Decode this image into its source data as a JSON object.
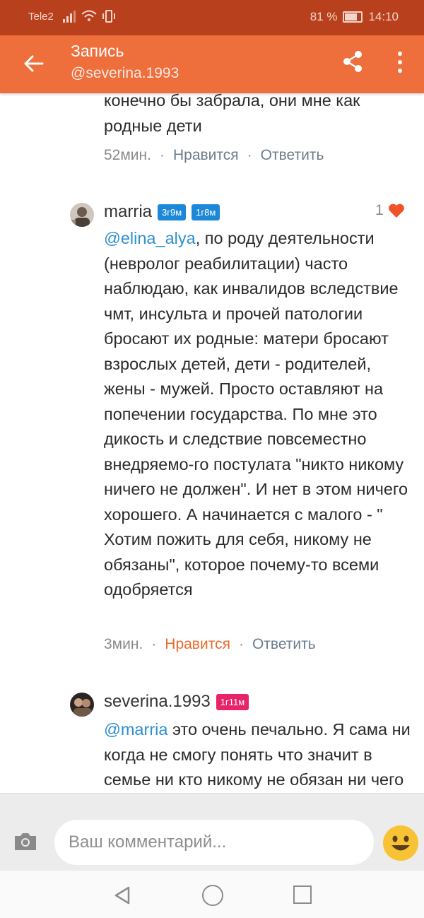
{
  "status_bar": {
    "carrier": "Tele2",
    "battery": "81 %",
    "time": "14:10"
  },
  "header": {
    "title": "Запись",
    "subtitle": "@severina.1993"
  },
  "comments": [
    {
      "text_tail": "конечно бы забрала, они мне как родные дети",
      "time": "52мин.",
      "like_label": "Нравится",
      "reply_label": "Ответить"
    },
    {
      "username": "marria",
      "badges": [
        "3г9м",
        "1г8м"
      ],
      "like_count": "1",
      "mention": "@elina_alya",
      "text": ",  по роду деятельности (невролог реабилитации) часто наблюдаю,  как инвалидов вследствие чмт,  инсульта и прочей патологии бросают их родные: матери бросают взрослых детей, дети - родителей,  жены - мужей. Просто оставляют на попечении государства.  По мне это дикость и следствие повсеместно внедряемо-го постулата \"никто никому ничего не должен\". И нет в этом ничего хорошего.  А начинается с малого - \" Хотим пожить для себя, никому не обязаны\",  которое почему-то всеми одобряется",
      "time": "3мин.",
      "like_label": "Нравится",
      "reply_label": "Ответить"
    },
    {
      "username": "severina.1993",
      "badges": [
        "1г11м"
      ],
      "mention": "@marria",
      "text": " это очень печально. Я сама ни когда не смогу понять что значит в семье ни кто никому не обязан ни чего и не должен."
    }
  ],
  "composer": {
    "placeholder": "Ваш комментарий..."
  },
  "colors": {
    "status_bar": "#b8401d",
    "app_bar": "#ee6e3c",
    "mention": "#2d8fd2",
    "liked": "#ea6a2a",
    "heart": "#f0522a"
  },
  "icons": [
    "back-arrow-icon",
    "share-icon",
    "more-vert-icon",
    "heart-icon",
    "camera-icon",
    "smiley-icon",
    "nav-back-icon",
    "nav-home-icon",
    "nav-recent-icon"
  ]
}
